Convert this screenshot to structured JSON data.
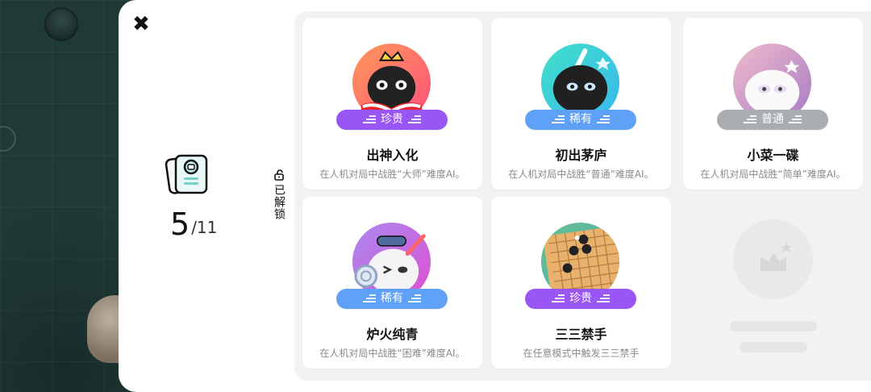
{
  "modal": {
    "close_symbol": "✖",
    "summary": {
      "unlocked": "5",
      "total": "/11",
      "vertical_label": "已解锁"
    },
    "achievements": [
      {
        "title": "出神入化",
        "desc": "在人机对局中战胜“大师”难度AI。",
        "badge": "珍贵",
        "rarity": "precious",
        "badge_color": "#9a55f5",
        "icon": "bomb-king-icon"
      },
      {
        "title": "初出茅庐",
        "desc": "在人机对局中战胜“普通”难度AI。",
        "badge": "稀有",
        "rarity": "rare",
        "badge_color": "#5ea1f6",
        "icon": "bomb-sword-icon"
      },
      {
        "title": "小菜一碟",
        "desc": "在人机对局中战胜“简单”难度AI。",
        "badge": "普通",
        "rarity": "common",
        "badge_color": "#a8adb2",
        "icon": "white-blob-icon"
      },
      {
        "title": "炉火纯青",
        "desc": "在人机对局中战胜“困难”难度AI。",
        "badge": "稀有",
        "rarity": "rare",
        "badge_color": "#5ea1f6",
        "icon": "blob-knight-icon"
      },
      {
        "title": "三三禁手",
        "desc": "在任意模式中触发三三禁手",
        "badge": "珍贵",
        "rarity": "precious",
        "badge_color": "#9a55f5",
        "icon": "gomoku-board-icon"
      }
    ],
    "locked_placeholder": {
      "icon": "locked-achievement-icon"
    }
  },
  "colors": {
    "background": "#1f3b36",
    "modal": "#ffffff",
    "panel": "#f2f2f2",
    "precious": "#9a55f5",
    "rare": "#5ea1f6",
    "common": "#a8adb2"
  }
}
